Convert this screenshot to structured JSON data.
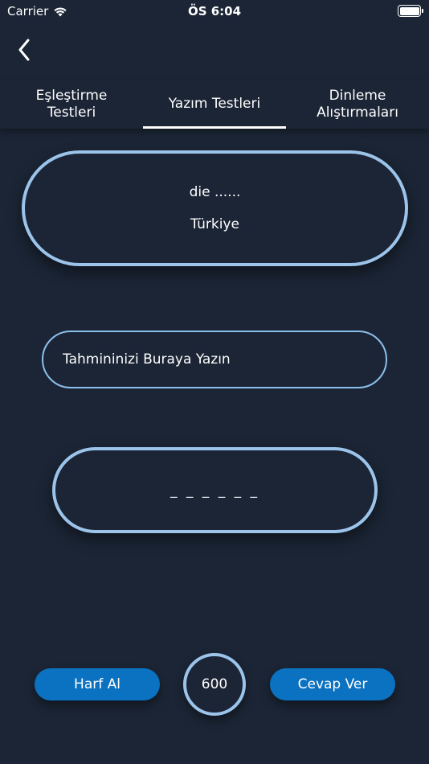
{
  "status_bar": {
    "carrier": "Carrier",
    "time": "ÖS 6:04"
  },
  "tabs": [
    {
      "label": "Eşleştirme\nTestleri",
      "active": false
    },
    {
      "label": "Yazım Testleri",
      "active": true
    },
    {
      "label": "Dinleme\nAlıştırmaları",
      "active": false
    }
  ],
  "question": {
    "prompt": "die ......",
    "translation": "Türkiye"
  },
  "guess_input": {
    "placeholder": "Tahmininizi Buraya Yazın",
    "value": ""
  },
  "answer": {
    "masked": "_ _ _ _ _ _"
  },
  "buttons": {
    "hint_label": "Harf Al",
    "submit_label": "Cevap Ver"
  },
  "score": {
    "value": "600"
  },
  "colors": {
    "background": "#1b2535",
    "border": "#9cc4ea",
    "button": "#0a72c0",
    "text": "#ffffff"
  },
  "icons": {
    "back": "chevron-left-icon",
    "wifi": "wifi-icon",
    "battery": "battery-icon"
  }
}
